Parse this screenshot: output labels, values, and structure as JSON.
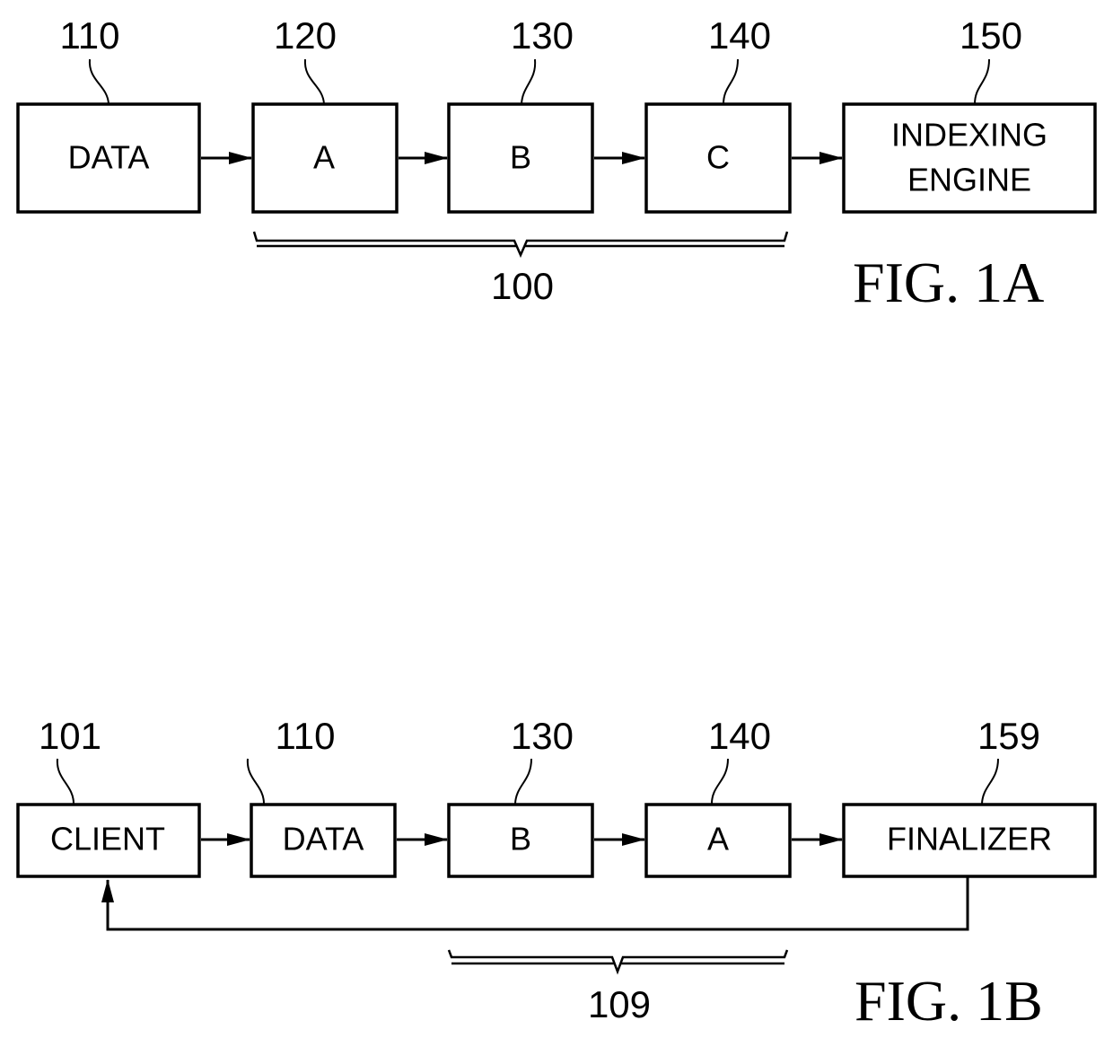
{
  "figures": [
    {
      "id": "fig1a",
      "caption": "FIG. 1A",
      "blocks": [
        {
          "ref": "110",
          "lines": [
            "DATA"
          ]
        },
        {
          "ref": "120",
          "lines": [
            "A"
          ]
        },
        {
          "ref": "130",
          "lines": [
            "B"
          ]
        },
        {
          "ref": "140",
          "lines": [
            "C"
          ]
        },
        {
          "ref": "150",
          "lines": [
            "INDEXING",
            "ENGINE"
          ]
        }
      ],
      "group": {
        "ref": "100",
        "spans": [
          "120",
          "130",
          "140"
        ]
      },
      "flow": [
        "110→120",
        "120→130",
        "130→140",
        "140→150"
      ]
    },
    {
      "id": "fig1b",
      "caption": "FIG. 1B",
      "blocks": [
        {
          "ref": "101",
          "lines": [
            "CLIENT"
          ]
        },
        {
          "ref": "110",
          "lines": [
            "DATA"
          ]
        },
        {
          "ref": "130",
          "lines": [
            "B"
          ]
        },
        {
          "ref": "140",
          "lines": [
            "A"
          ]
        },
        {
          "ref": "159",
          "lines": [
            "FINALIZER"
          ]
        }
      ],
      "group": {
        "ref": "109",
        "spans": [
          "130",
          "140"
        ]
      },
      "flow": [
        "101→110",
        "110→130",
        "130→140",
        "140→159",
        "159→101 (feedback)"
      ]
    }
  ]
}
